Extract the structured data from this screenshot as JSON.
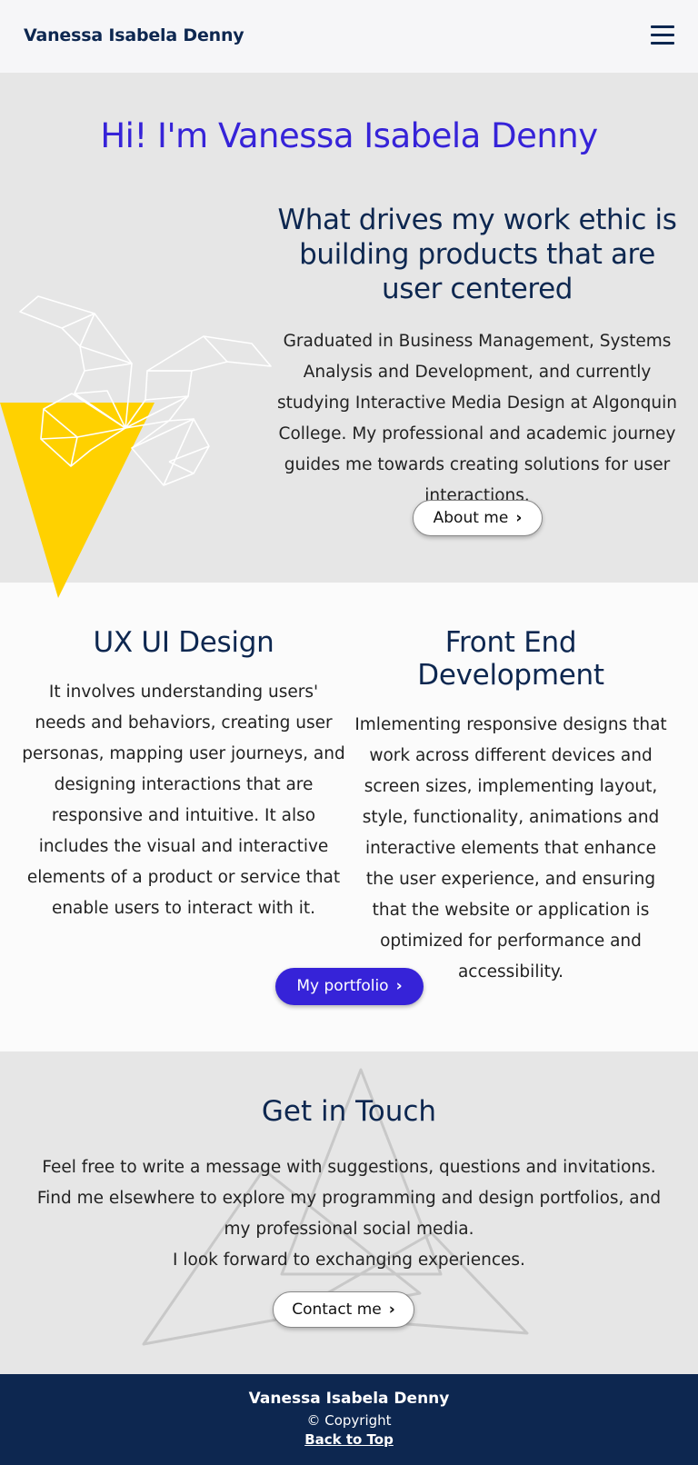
{
  "header": {
    "brand": "Vanessa Isabela Denny",
    "menu_icon": "hamburger-menu-icon"
  },
  "hero": {
    "title": "Hi! I'm Vanessa Isabela Denny",
    "subtitle": "What drives my work ethic is building products that are user centered",
    "paragraph": "Graduated in Business Management, Systems Analysis and Development, and currently studying Interactive Media Design at Algonquin College. My professional and academic journey guides me towards creating solutions for user interactions.",
    "button_label": "About me",
    "accent_color": "#ffd100"
  },
  "services": [
    {
      "title": "UX UI Design",
      "description": "It involves understanding users' needs and behaviors, creating user personas, mapping user journeys, and designing interactions that are responsive and intuitive. It also includes the visual and interactive elements of a product or service that enable users to interact with it."
    },
    {
      "title": "Front End Development",
      "description": "Imlementing responsive designs that work across different devices and screen sizes, implementing layout, style, functionality, animations and interactive elements that enhance the user experience, and ensuring that the website or application is optimized for performance and accessibility."
    }
  ],
  "portfolio_button": "My portfolio",
  "contact": {
    "title": "Get in Touch",
    "lines": [
      "Feel free to write a message with suggestions, questions and invitations.",
      "Find me elsewhere to explore my programming and design portfolios, and my professional social media.",
      "I look forward to exchanging experiences."
    ],
    "button_label": "Contact me"
  },
  "footer": {
    "name": "Vanessa Isabela Denny",
    "copyright": "© Copyright",
    "back_to_top": "Back to Top"
  },
  "colors": {
    "primary": "#3623d8",
    "navy": "#0d2750",
    "yellow": "#ffd100"
  }
}
